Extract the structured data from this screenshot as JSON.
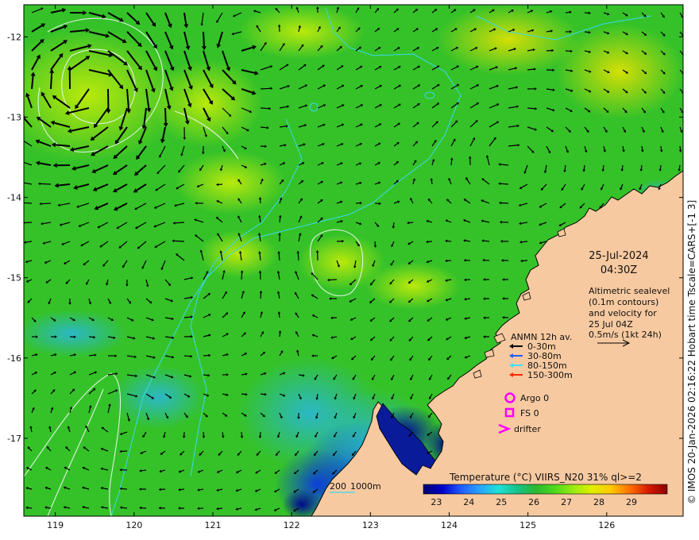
{
  "date": "25-Jul-2024",
  "time": "04:30Z",
  "altimetry": {
    "lines": [
      "Altimetric sealevel",
      "(0.1m contours)",
      "and velocity for",
      "25 Jul 04Z",
      "0.5m/s (1kt 24h)"
    ]
  },
  "legend": {
    "title": "ANMN 12h av.",
    "items": [
      {
        "label": "0-30m",
        "color": "#000000"
      },
      {
        "label": "30-80m",
        "color": "#1e5fff"
      },
      {
        "label": "80-150m",
        "color": "#40e0ff"
      },
      {
        "label": "150-300m",
        "color": "#ff2a00"
      }
    ],
    "argo": "Argo 0",
    "fs": "FS 0",
    "drifter": "drifter",
    "marker_color": "#ff00ff"
  },
  "depth_scale": {
    "label1": "200",
    "label2": "1000m"
  },
  "colorbar": {
    "title": "Temperature (°C) VIIRS_N20 31% ql>=2",
    "ticks": [
      "23",
      "24",
      "25",
      "26",
      "27",
      "28",
      "29"
    ],
    "range": [
      22.6,
      30.1
    ],
    "colors": [
      "#000070",
      "#0000c8",
      "#1f5bff",
      "#2aa4ff",
      "#1fe0d8",
      "#16c28a",
      "#2bb82f",
      "#4ed81e",
      "#9aeb10",
      "#e0ef00",
      "#ffc800",
      "#ff7000",
      "#d61a00",
      "#8a0000"
    ]
  },
  "credit": "© IMOS 20-Jan-2026 02:16:22 Hobart time Tscale=CARS+[-1 3]",
  "axes": {
    "x_ticks": [
      "119",
      "120",
      "121",
      "122",
      "123",
      "124",
      "125",
      "126"
    ],
    "y_ticks": [
      "-12",
      "-13",
      "-14",
      "-15",
      "-16",
      "-17"
    ],
    "lon_range": [
      118.6,
      126.97
    ],
    "lat_range": [
      -17.97,
      -11.6
    ]
  },
  "land_color": "#f7c9a0"
}
